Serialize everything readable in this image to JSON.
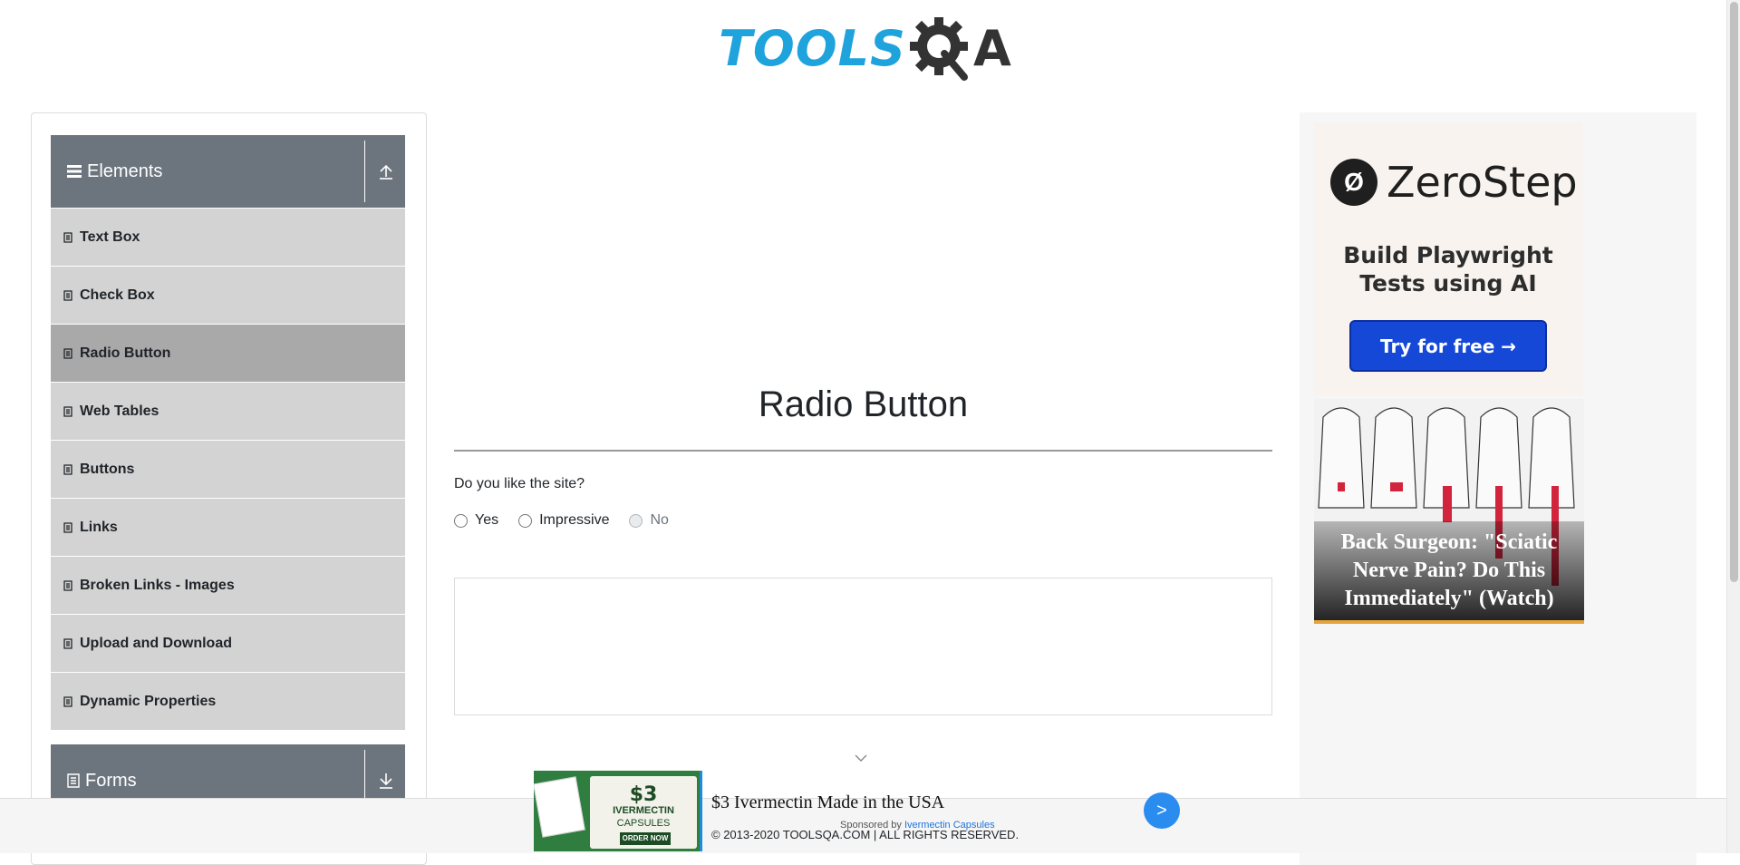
{
  "header": {
    "logo_text": "TOOLS",
    "logo_suffix": "A"
  },
  "sidebar": {
    "groups": [
      {
        "label": "Elements",
        "toggle_icon": "arrow-up-icon"
      },
      {
        "label": "Forms",
        "toggle_icon": "arrow-down-icon"
      }
    ],
    "items": [
      {
        "label": "Text Box"
      },
      {
        "label": "Check Box"
      },
      {
        "label": "Radio Button",
        "active": true
      },
      {
        "label": "Web Tables"
      },
      {
        "label": "Buttons"
      },
      {
        "label": "Links"
      },
      {
        "label": "Broken Links - Images"
      },
      {
        "label": "Upload and Download"
      },
      {
        "label": "Dynamic Properties"
      }
    ]
  },
  "main": {
    "title": "Radio Button",
    "question": "Do you like the site?",
    "options": [
      {
        "label": "Yes",
        "disabled": false
      },
      {
        "label": "Impressive",
        "disabled": false
      },
      {
        "label": "No",
        "disabled": true
      }
    ]
  },
  "right_ad": {
    "brand_mark": "Ø",
    "brand": "ZeroStep",
    "subtitle_line1": "Build Playwright",
    "subtitle_line2": "Tests using AI",
    "cta": "Try for free →",
    "article_title": "Back Surgeon: \"Sciatic Nerve Pain? Do This Immediately\" (Watch)"
  },
  "bottom_ad": {
    "thumb_price": "$3",
    "thumb_name": "IVERMECTIN",
    "thumb_form": "CAPSULES",
    "thumb_cta": "ORDER NOW",
    "headline": "$3 Ivermectin Made in the USA",
    "sponsor_prefix": "Sponsored by ",
    "sponsor_name": "Ivermectin Capsules",
    "go_label": ">"
  },
  "footer": {
    "copyright": "© 2013-2020 TOOLSQA.COM | ALL RIGHTS RESERVED."
  },
  "colors": {
    "brand_blue": "#1fa3dc",
    "group_header": "#6c757d",
    "menu_item": "#d3d3d3",
    "menu_active": "#a9a9a9",
    "cta_blue": "#1548d6"
  }
}
